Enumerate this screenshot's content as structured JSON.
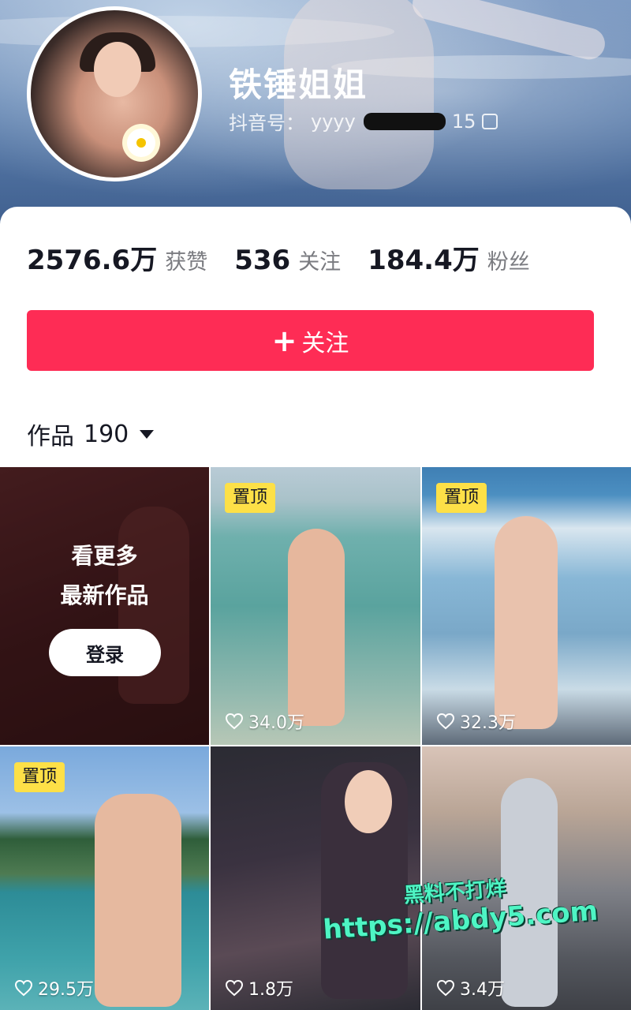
{
  "profile": {
    "name": "铁锤姐姐",
    "douyin_id_label": "抖音号：",
    "douyin_id_visible": "yyyy",
    "douyin_id_suffix": "15"
  },
  "stats": [
    {
      "value": "2576.6万",
      "label": "获赞"
    },
    {
      "value": "536",
      "label": "关注"
    },
    {
      "value": "184.4万",
      "label": "粉丝"
    }
  ],
  "follow_button": {
    "icon": "+",
    "label": "关注"
  },
  "works_tab": {
    "label": "作品",
    "count": "190"
  },
  "login_tile": {
    "line1": "看更多",
    "line2": "最新作品",
    "button": "登录"
  },
  "pin_label": "置顶",
  "videos": [
    {
      "pinned": true,
      "likes": "34.0万"
    },
    {
      "pinned": true,
      "likes": "32.3万"
    },
    {
      "pinned": true,
      "likes": "29.5万"
    },
    {
      "pinned": false,
      "likes": "1.8万"
    },
    {
      "pinned": false,
      "likes": "3.4万"
    }
  ],
  "watermark": {
    "line1": "黑料不打烊",
    "line2": "https://abdy5.com"
  },
  "colors": {
    "accent": "#fe2c55",
    "pin": "#fde047",
    "watermark": "#4ef5c4"
  }
}
